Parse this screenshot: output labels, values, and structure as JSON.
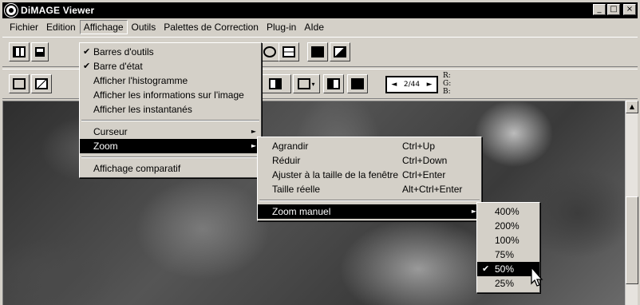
{
  "window": {
    "title": "DiMAGE Viewer",
    "controls": [
      "_",
      "□",
      "×"
    ]
  },
  "menubar": [
    {
      "label": "Fichier"
    },
    {
      "label": "Edition"
    },
    {
      "label": "Affichage"
    },
    {
      "label": "Outils"
    },
    {
      "label": "Palettes de Correction"
    },
    {
      "label": "Plug-in"
    },
    {
      "label": "AIde"
    }
  ],
  "toolbar2": {
    "frame_counter": "2/44",
    "rgb_labels": [
      "R:",
      "G:",
      "B:"
    ]
  },
  "affichage_menu": {
    "items": [
      {
        "label": "Barres d'outils",
        "checked": true
      },
      {
        "label": "Barre d'état",
        "checked": true
      },
      {
        "label": "Afficher l'histogramme"
      },
      {
        "label": "Afficher les informations sur l'image"
      },
      {
        "label": "Afficher les instantanés"
      },
      {
        "label": "Curseur",
        "submenu": true
      },
      {
        "label": "Zoom",
        "submenu": true,
        "highlighted": true
      },
      {
        "label": "Affichage comparatif"
      }
    ]
  },
  "zoom_menu": {
    "items": [
      {
        "label": "Agrandir",
        "shortcut": "Ctrl+Up"
      },
      {
        "label": "Réduir",
        "shortcut": "Ctrl+Down"
      },
      {
        "label": "Ajuster à la taille de la fenêtre",
        "shortcut": "Ctrl+Enter"
      },
      {
        "label": "Taille réelle",
        "shortcut": "Alt+Ctrl+Enter"
      },
      {
        "label": "Zoom manuel",
        "submenu": true,
        "highlighted": true
      }
    ]
  },
  "zoom_manual_menu": {
    "items": [
      {
        "label": "400%"
      },
      {
        "label": "200%"
      },
      {
        "label": "100%"
      },
      {
        "label": "75%"
      },
      {
        "label": "50%",
        "checked": true,
        "highlighted": true
      },
      {
        "label": "25%"
      }
    ]
  },
  "icons": {
    "check": "✔",
    "submenu_arrow": "►",
    "dropdown_arrow": "▾",
    "scroll_up": "▲",
    "arrow_left": "◄",
    "arrow_right": "►"
  },
  "colors": {
    "highlight": "#000000",
    "face": "#d4d0c8",
    "titlebar": "#000000"
  }
}
